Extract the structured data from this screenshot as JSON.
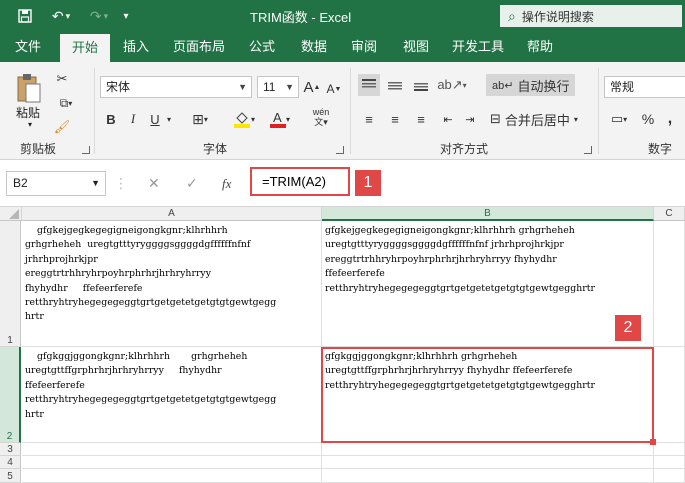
{
  "window": {
    "title": "TRIM函数  -  Excel",
    "tell_me": "操作说明搜索"
  },
  "menu": {
    "tabs": [
      "文件",
      "开始",
      "插入",
      "页面布局",
      "公式",
      "数据",
      "审阅",
      "视图",
      "开发工具",
      "帮助"
    ],
    "active_tab": "开始"
  },
  "ribbon": {
    "clipboard": {
      "paste": "粘贴",
      "label": "剪贴板"
    },
    "font": {
      "name": "宋体",
      "size": "11",
      "label": "字体",
      "bold": "B",
      "italic": "I",
      "underline": "U"
    },
    "alignment": {
      "wrap_text": "自动换行",
      "merge_center": "合并后居中",
      "label": "对齐方式"
    },
    "number": {
      "format": "常规",
      "label": "数字",
      "percent": "%",
      "comma": ","
    }
  },
  "formula_bar": {
    "name_box": "B2",
    "formula": "=TRIM(A2)",
    "fx": "fx",
    "badge_1": "1"
  },
  "sheet": {
    "columns": [
      "A",
      "B",
      "C"
    ],
    "rows": [
      "1",
      "2",
      "3",
      "4",
      "5"
    ],
    "selected_cell": "B2",
    "badge_2": "2",
    "cells": {
      "A1": "    gfgkejgegkegegigneigongkgnr;klhrhhrh\ngrhgrheheh  uregtgtttyryggggsggggdgffffffnfnf\njrhrhprojhrkjpr\nereggtrtrhhryhrpoyhrphrhrjhrhryhrryy\nfhyhydhr     ffefeerferefe\nretthryhtryhegegegeggtgrtgetgetetgetgtgtgewtgegg\nhrtr",
      "B1": "gfgkejgegkegegigneigongkgnr;klhrhhrh grhgrheheh\nuregtgtttyryggggsggggdgffffffnfnf jrhrhprojhrkjpr\nereggtrtrhhryhrpoyhrphrhrjhrhryhrryy fhyhydhr\nffefeerferefe\nretthryhtryhegegegeggtgrtgetgetetgetgtgtgewtgegghrtr",
      "A2": "    gfgkggjggongkgnr;klhrhhrh       grhgrheheh\nuregtgttffgrphrhrjhrhryhrryy     fhyhydhr\nffefeerferefe\nretthryhtryhegegegeggtgrtgetgetetgetgtgtgewtgegg\nhrtr",
      "B2": "gfgkggjggongkgnr;klhrhhrh grhgrheheh\nuregtgttffgrphrhrjhrhryhrryy fhyhydhr ffefeerferefe\nretthryhtryhegegegeggtgrtgetgetetgetgtgtgewtgegghrtr"
    }
  },
  "colors": {
    "excel_green": "#217346",
    "highlight_red": "#e04848"
  }
}
